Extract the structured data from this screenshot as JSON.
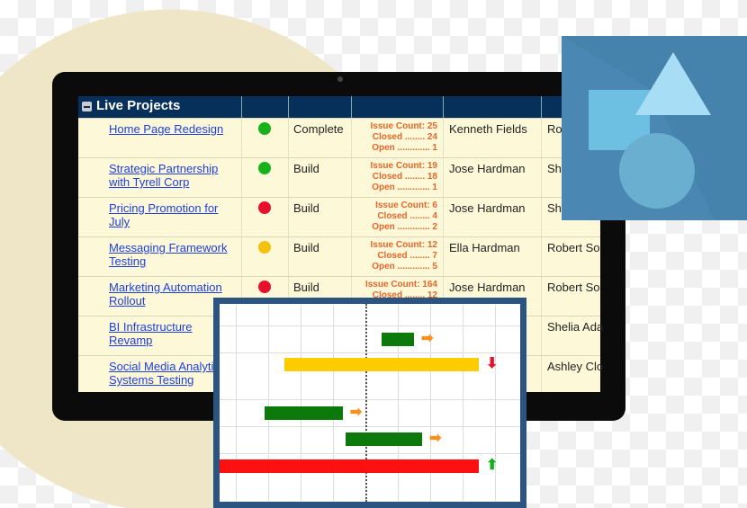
{
  "table": {
    "title": "Live Projects",
    "rows": [
      {
        "name": "Home Page Redesign",
        "status_color": "#17b21a",
        "phase": "Complete",
        "issue_count": "Issue Count: 25",
        "closed": "Closed ........ 24",
        "open": "Open ............. 1",
        "owner": "Kenneth Fields",
        "other": "Ro"
      },
      {
        "name": "Strategic Partnership with Tyrell Corp",
        "status_color": "#17b21a",
        "phase": "Build",
        "issue_count": "Issue Count: 19",
        "closed": "Closed ........ 18",
        "open": "Open ............. 1",
        "owner": "Jose Hardman",
        "other": "Sh"
      },
      {
        "name": "Pricing Promotion for July",
        "status_color": "#e8112d",
        "phase": "Build",
        "issue_count": "Issue Count: 6",
        "closed": "Closed ........ 4",
        "open": "Open ............. 2",
        "owner": "Jose Hardman",
        "other": "Sh"
      },
      {
        "name": "Messaging Framework Testing",
        "status_color": "#f4c20d",
        "phase": "Build",
        "issue_count": "Issue Count: 12",
        "closed": "Closed ........ 7",
        "open": "Open ............. 5",
        "owner": "Ella Hardman",
        "other": "Robert So"
      },
      {
        "name": "Marketing Automation Rollout",
        "status_color": "#e8112d",
        "phase": "Build",
        "issue_count": "Issue Count: 164",
        "closed": "Closed ........ 12",
        "open": "",
        "owner": "Jose Hardman",
        "other": "Robert So"
      },
      {
        "name": "BI Infrastructure Revamp",
        "status_color": "",
        "phase": "",
        "issue_count": "",
        "closed": "",
        "open": "",
        "owner": "",
        "other": "Shelia Ada"
      },
      {
        "name": "Social Media Analytics Systems Testing",
        "status_color": "",
        "phase": "",
        "issue_count": "",
        "closed": "",
        "open": "",
        "owner": "",
        "other": "Ashley Clo"
      }
    ]
  },
  "gantt": {
    "bars": [
      {
        "start": 4.5,
        "end": 5.5,
        "color": "#0b7a0b",
        "trend": "right",
        "trend_color": "#f7901e"
      },
      {
        "start": 1.5,
        "end": 7.5,
        "color": "#ffcc00",
        "trend": "down",
        "trend_color": "#e8112d"
      },
      {
        "start": 0.9,
        "end": 3.3,
        "color": "#0b7a0b",
        "trend": "right",
        "trend_color": "#f7901e"
      },
      {
        "start": 3.4,
        "end": 5.75,
        "color": "#0b7a0b",
        "trend": "right",
        "trend_color": "#f7901e"
      },
      {
        "start": 0,
        "end": 7.5,
        "color": "#ff1010",
        "trend": "up",
        "trend_color": "#11b11a"
      }
    ]
  }
}
